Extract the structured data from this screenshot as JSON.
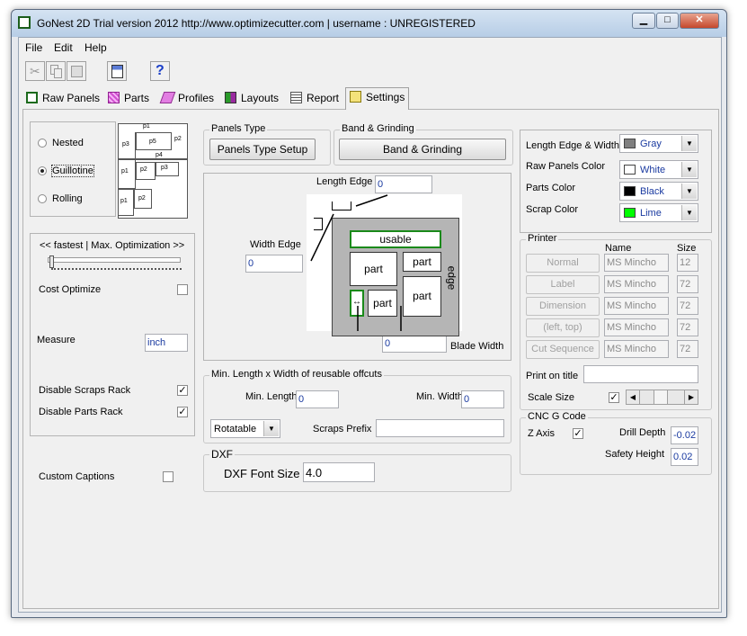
{
  "window": {
    "title": "GoNest 2D Trial version  2012  http://www.optimizecutter.com | username : UNREGISTERED",
    "minimize": "▁",
    "maximize": "□",
    "close": "✕"
  },
  "menu": [
    "File",
    "Edit",
    "Help"
  ],
  "toolbar": {
    "cut_icon": "scissors-icon",
    "copy_icon": "copy-icon",
    "paste_icon": "paste-icon",
    "calc_icon": "calculator-icon",
    "help_icon": "help-icon",
    "help_glyph": "?"
  },
  "tabs": [
    {
      "label": "Raw Panels",
      "icon": "raw-panels-icon"
    },
    {
      "label": "Parts",
      "icon": "parts-icon"
    },
    {
      "label": "Profiles",
      "icon": "profiles-icon"
    },
    {
      "label": "Layouts",
      "icon": "layouts-icon"
    },
    {
      "label": "Report",
      "icon": "report-icon"
    },
    {
      "label": "Settings",
      "icon": "settings-icon",
      "active": true
    }
  ],
  "method": {
    "options": [
      "Nested",
      "Guillotine",
      "Rolling"
    ],
    "selected": "Guillotine",
    "preview_labels": [
      "p1",
      "p2",
      "p3",
      "p5",
      "p4",
      "p1",
      "p2",
      "p3",
      "p1",
      "p2"
    ]
  },
  "optimization": {
    "label": "<< fastest  |  Max.  Optimization >>",
    "level": 0.0,
    "cost_optimize_label": "Cost Optimize",
    "cost_optimize": false,
    "measure_label": "Measure",
    "measure_value": "inch",
    "disable_scraps_label": "Disable Scraps Rack",
    "disable_scraps": true,
    "disable_parts_label": "Disable Parts Rack",
    "disable_parts": true
  },
  "custom_captions": {
    "label": "Custom Captions",
    "checked": false
  },
  "panels_type": {
    "legend": "Panels Type",
    "button": "Panels Type Setup"
  },
  "band_grinding": {
    "legend": "Band & Grinding",
    "button": "Band & Grinding"
  },
  "diagram": {
    "length_edge_label": "Length Edge",
    "length_edge_value": "0",
    "width_edge_label": "Width Edge",
    "width_edge_value": "0",
    "blade_width_label": "Blade Width",
    "blade_width_value": "0",
    "usable": "usable",
    "part": "part",
    "edge": "edge",
    "arrow_glyph": "↔"
  },
  "offcuts": {
    "legend": "Min. Length x Width of reusable offcuts",
    "min_length_label": "Min. Length",
    "min_length_value": "0",
    "min_width_label": "Min. Width",
    "min_width_value": "0",
    "rotatable": "Rotatable",
    "scraps_prefix_label": "Scraps Prefix",
    "scraps_prefix_value": ""
  },
  "dxf": {
    "legend": "DXF",
    "font_size_label": "DXF Font Size",
    "font_size_value": "4.0"
  },
  "colors": {
    "length_edge_label": "Length Edge & Width",
    "length_edge_color": "Gray",
    "length_edge_hex": "#808080",
    "raw_panels_label": "Raw Panels Color",
    "raw_panels_color": "White",
    "raw_panels_hex": "#ffffff",
    "parts_label": "Parts Color",
    "parts_color": "Black",
    "parts_hex": "#000000",
    "scrap_label": "Scrap Color",
    "scrap_color": "Lime",
    "scrap_hex": "#00ff00"
  },
  "printer": {
    "legend": "Printer",
    "name_header": "Name",
    "size_header": "Size",
    "rows": [
      {
        "button": "Normal",
        "font": "MS Mincho",
        "size": "12"
      },
      {
        "button": "Label",
        "font": "MS Mincho",
        "size": "72"
      },
      {
        "button": "Dimension",
        "font": "MS Mincho",
        "size": "72"
      },
      {
        "button": "(left, top)",
        "font": "MS Mincho",
        "size": "72"
      },
      {
        "button": "Cut Sequence",
        "font": "MS Mincho",
        "size": "72"
      }
    ],
    "print_on_title_label": "Print on title",
    "print_on_title_value": "",
    "scale_size_label": "Scale Size",
    "scale_size_checked": true
  },
  "cnc": {
    "legend": "CNC G Code",
    "z_axis_label": "Z Axis",
    "z_axis_checked": true,
    "drill_depth_label": "Drill Depth",
    "drill_depth_value": "-0.02",
    "safety_height_label": "Safety Height",
    "safety_height_value": "0.02"
  }
}
